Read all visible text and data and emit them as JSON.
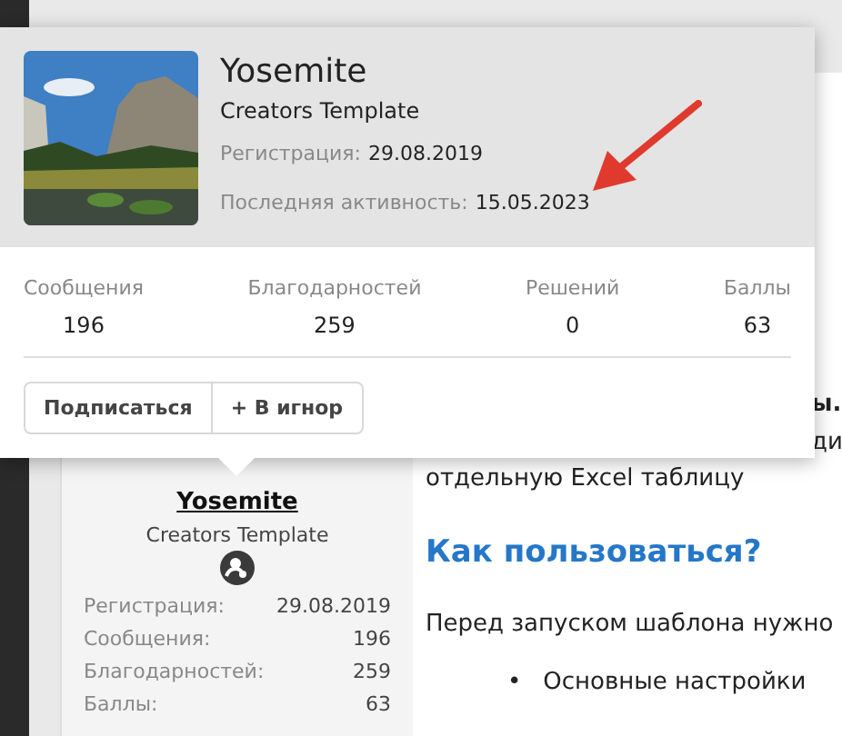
{
  "popup": {
    "name": "Yosemite",
    "title": "Creators Template",
    "registration": {
      "label": "Регистрация:",
      "value": "29.08.2019"
    },
    "last_activity": {
      "label": "Последняя активность:",
      "value": "15.05.2023"
    },
    "stats": [
      {
        "label": "Сообщения",
        "value": "196"
      },
      {
        "label": "Благодарностей",
        "value": "259"
      },
      {
        "label": "Решений",
        "value": "0"
      },
      {
        "label": "Баллы",
        "value": "63"
      }
    ],
    "buttons": [
      "Подписаться",
      "+ В игнор"
    ]
  },
  "sidebar": {
    "name": "Yosemite",
    "title": "Creators Template",
    "rows": [
      {
        "label": "Регистрация:",
        "value": "29.08.2019"
      },
      {
        "label": "Сообщения:",
        "value": "196"
      },
      {
        "label": "Благодарностей:",
        "value": "259"
      },
      {
        "label": "Баллы:",
        "value": "63"
      }
    ]
  },
  "content": {
    "fragments": [
      "ы.",
      "ди"
    ],
    "line": "отдельную Excel таблицу",
    "heading": "Как пользоваться?",
    "paragraph": "Перед запуском шаблона нужно",
    "bullets": [
      {
        "marker": "•",
        "text": "Основные настройки"
      }
    ]
  }
}
